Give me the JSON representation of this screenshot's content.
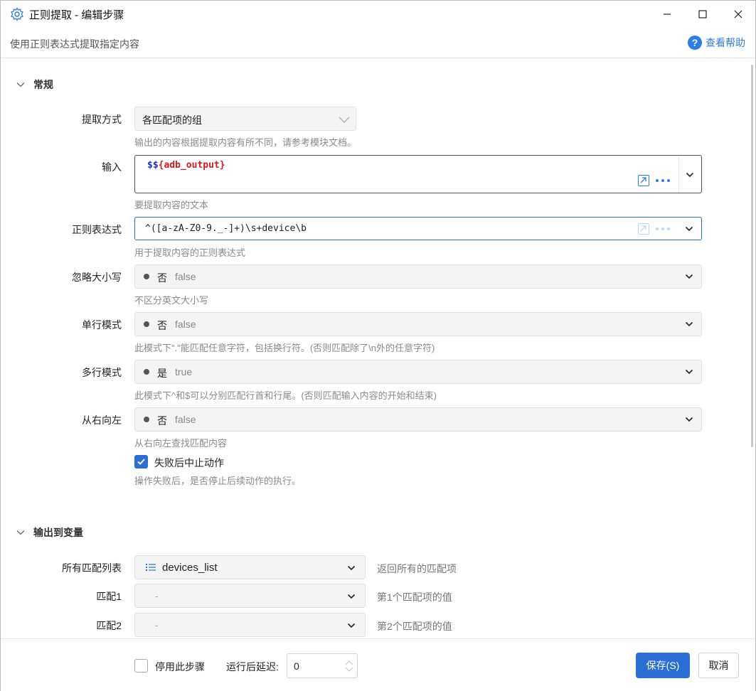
{
  "window": {
    "title": "正则提取 - 编辑步骤",
    "subtitle": "使用正则表达式提取指定内容",
    "help_label": "查看帮助"
  },
  "general": {
    "section_title": "常规",
    "extract_mode": {
      "label": "提取方式",
      "value": "各匹配项的组",
      "hint": "输出的内容根据提取内容有所不同，请参考模块文档。"
    },
    "input": {
      "label": "输入",
      "prefix": "$$",
      "variable": "{adb_output}",
      "hint": "要提取内容的文本"
    },
    "regex": {
      "label": "正则表达式",
      "value": "^([a-zA-Z0-9._-]+)\\s+device\\b",
      "hint": "用于提取内容的正则表达式"
    },
    "ignore_case": {
      "label": "忽略大小写",
      "cn": "否",
      "en": "false",
      "hint": "不区分英文大小写"
    },
    "single_line": {
      "label": "单行模式",
      "cn": "否",
      "en": "false",
      "hint": "此模式下\".\"能匹配任意字符，包括换行符。(否则匹配除了\\n外的任意字符)"
    },
    "multi_line": {
      "label": "多行模式",
      "cn": "是",
      "en": "true",
      "hint": "此模式下^和$可以分别匹配行首和行尾。(否则匹配输入内容的开始和结束)"
    },
    "right_to_left": {
      "label": "从右向左",
      "cn": "否",
      "en": "false",
      "hint": "从右向左查找匹配内容"
    },
    "stop_on_fail": {
      "label": "失败后中止动作",
      "checked": true,
      "hint": "操作失败后，是否停止后续动作的执行。"
    }
  },
  "output": {
    "section_title": "输出到变量",
    "rows": [
      {
        "label": "所有匹配列表",
        "value": "devices_list",
        "desc": "返回所有的匹配项"
      },
      {
        "label": "匹配1",
        "value": "-",
        "desc": "第1个匹配项的值"
      },
      {
        "label": "匹配2",
        "value": "-",
        "desc": "第2个匹配项的值"
      }
    ]
  },
  "footer": {
    "disable_label": "停用此步骤",
    "disable_checked": false,
    "delay_label": "运行后延迟:",
    "delay_value": "0",
    "save_label": "保存(S)",
    "cancel_label": "取消"
  },
  "colors": {
    "accent": "#2b6fd6",
    "link": "#2b7de9"
  }
}
